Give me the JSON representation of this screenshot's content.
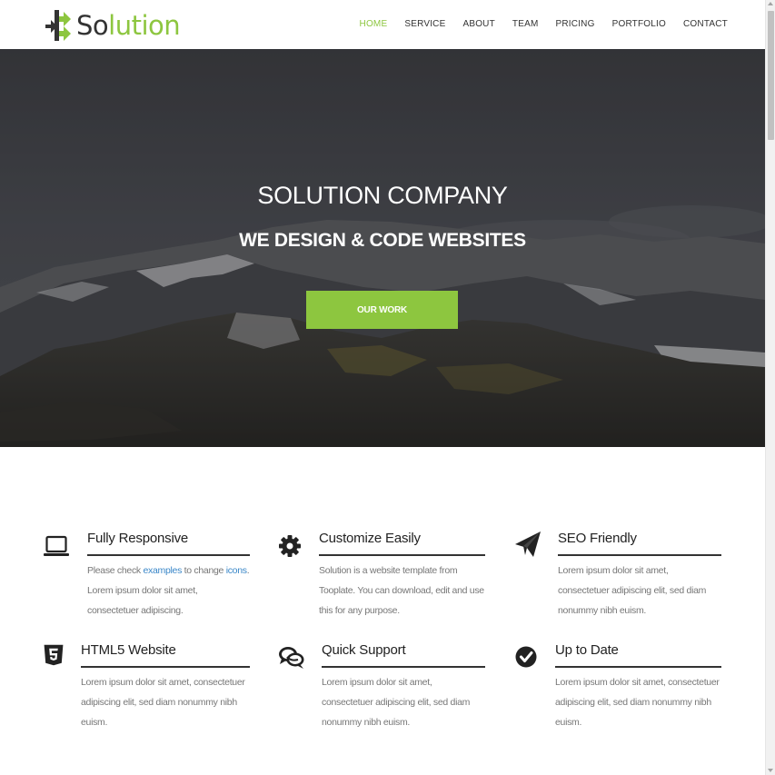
{
  "header": {
    "logo_text_a": "So",
    "logo_text_b": "lution",
    "nav": [
      {
        "label": "HOME",
        "active": true
      },
      {
        "label": "SERVICE"
      },
      {
        "label": "ABOUT"
      },
      {
        "label": "TEAM"
      },
      {
        "label": "PRICING"
      },
      {
        "label": "PORTFOLIO"
      },
      {
        "label": "CONTACT"
      }
    ]
  },
  "hero": {
    "title": "SOLUTION COMPANY",
    "subtitle": "WE DESIGN & CODE WEBSITES",
    "button": "OUR WORK"
  },
  "features": [
    {
      "icon": "laptop-icon",
      "title": "Fully Responsive",
      "text_pre": "Please check ",
      "link1": "examples",
      "text_mid": " to change ",
      "link2": "icons",
      "text_post": ". Lorem ipsum dolor sit amet, consectetuer adipiscing."
    },
    {
      "icon": "gear-icon",
      "title": "Customize Easily",
      "text": "Solution is a website template from Tooplate. You can download, edit and use this for any purpose."
    },
    {
      "icon": "paper-plane-icon",
      "title": "SEO Friendly",
      "text": "Lorem ipsum dolor sit amet, consectetuer adipiscing elit, sed diam nonummy nibh euism."
    },
    {
      "icon": "html5-icon",
      "title": "HTML5 Website",
      "text": "Lorem ipsum dolor sit amet, consectetuer adipiscing elit, sed diam nonummy nibh euism."
    },
    {
      "icon": "comments-icon",
      "title": "Quick Support",
      "text": "Lorem ipsum dolor sit amet, consectetuer adipiscing elit, sed diam nonummy nibh euism."
    },
    {
      "icon": "check-circle-icon",
      "title": "Up to Date",
      "text": "Lorem ipsum dolor sit amet, consectetuer adipiscing elit, sed diam nonummy nibh euism."
    }
  ],
  "colors": {
    "accent": "#8dc63f",
    "dark": "#333333",
    "link": "#3a87c8"
  }
}
